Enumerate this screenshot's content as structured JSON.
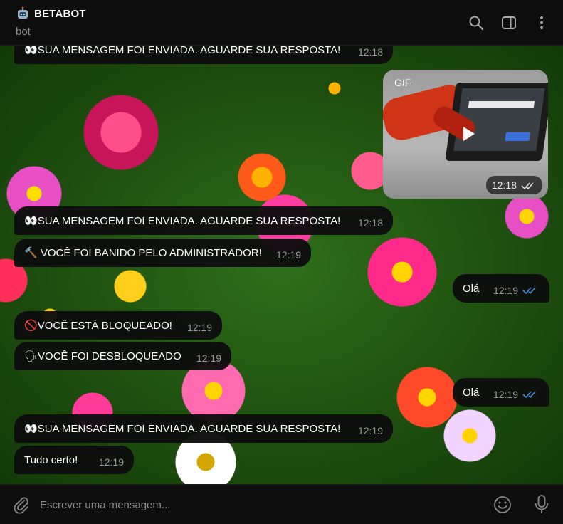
{
  "header": {
    "title": "BETABOT",
    "subtitle": "bot",
    "icons": [
      "robot-icon",
      "search-icon",
      "sidebar-toggle-icon",
      "more-menu-icon"
    ]
  },
  "messages": [
    {
      "dir": "in",
      "icon": "eyes-emoji",
      "text": "SUA MENSAGEM FOI ENVIADA. AGUARDE SUA RESPOSTA!",
      "time": "12:18"
    },
    {
      "dir": "out",
      "type": "gif",
      "label": "GIF",
      "time": "12:18",
      "read": true
    },
    {
      "dir": "in",
      "icon": "eyes-emoji",
      "text": "SUA MENSAGEM FOI ENVIADA. AGUARDE SUA RESPOSTA!",
      "time": "12:18"
    },
    {
      "dir": "in",
      "icon": "hammer-emoji",
      "text": "VOCÊ FOI BANIDO PELO ADMINISTRADOR!",
      "time": "12:19"
    },
    {
      "dir": "out",
      "text": "Olá",
      "time": "12:19",
      "read": true
    },
    {
      "dir": "in",
      "icon": "no-entry-emoji",
      "text": "VOCÊ ESTÁ BLOQUEADO!",
      "time": "12:19"
    },
    {
      "dir": "in",
      "icon": "speaking-head-emoji",
      "text": "VOCÊ FOI DESBLOQUEADO",
      "time": "12:19"
    },
    {
      "dir": "out",
      "text": "Olá",
      "time": "12:19",
      "read": true
    },
    {
      "dir": "in",
      "icon": "eyes-emoji",
      "text": "SUA MENSAGEM FOI ENVIADA. AGUARDE SUA RESPOSTA!",
      "time": "12:19"
    },
    {
      "dir": "in",
      "text": "Tudo certo!",
      "time": "12:19"
    }
  ],
  "composer": {
    "placeholder": "Escrever uma mensagem..."
  },
  "colors": {
    "bubble": "#0e0e0e",
    "read_ticks": "#4a90e2",
    "header_bg": "#0e0e0e",
    "secondary_text": "#8a8a8a"
  }
}
